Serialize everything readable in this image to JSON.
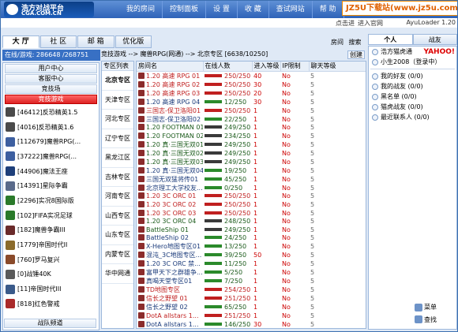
{
  "app": {
    "logo_line1": "浩方对战平台",
    "logo_line2": "CGA.COM.CN",
    "watermark": "JZ5U下载站(www.jz5u.com)"
  },
  "menu": [
    "我的房间",
    "控制面板",
    "设 置",
    "收 藏",
    "查试网站",
    "帮 助"
  ],
  "row2": {
    "link": "点击进",
    "link2": "进入官网",
    "user": "AyuLoader 1.20"
  },
  "tabs": [
    "大 厅",
    "社 区",
    "邮 箱",
    "优化版"
  ],
  "online_text": "在线/游戏: 286648 /268751",
  "categories": [
    {
      "label": "用户中心",
      "active": false
    },
    {
      "label": "客服中心",
      "active": false
    },
    {
      "label": "竞技场",
      "active": false
    },
    {
      "label": "竞技游戏",
      "active": true
    }
  ],
  "games": [
    {
      "label": "[46412]反恐精英1.5",
      "icon_color": "#4a4a4a"
    },
    {
      "label": "[4016]反恐精英1.6",
      "icon_color": "#4a4a4a"
    },
    {
      "label": "[112679]魔兽RPG(...",
      "icon_color": "#3d5fa0"
    },
    {
      "label": "[37222]魔兽RPG(...",
      "icon_color": "#3d5fa0"
    },
    {
      "label": "[44906]魔法王座",
      "icon_color": "#1e3f7a"
    },
    {
      "label": "[14391]星际争霸",
      "icon_color": "#5a6a8a"
    },
    {
      "label": "[2296]实况8国际版",
      "icon_color": "#2a7a2a"
    },
    {
      "label": "[102]FIFA实况足球",
      "icon_color": "#2a7a2a"
    },
    {
      "label": "[182]魔兽争霸III",
      "icon_color": "#6a2a2a"
    },
    {
      "label": "[1779]帝国时代II",
      "icon_color": "#8a6a2a"
    },
    {
      "label": "[760]罗马复兴",
      "icon_color": "#8a4a2a"
    },
    {
      "label": "[0]战锤40K",
      "icon_color": "#5a5a5a"
    },
    {
      "label": "[11]帝国时代III",
      "icon_color": "#3a5a8a"
    },
    {
      "label": "[818]红色警戒",
      "icon_color": "#aa2a2a"
    }
  ],
  "bottom_category": "战队频道",
  "breadcrumb": "竞技游戏 --> 魔兽RPG(网通) --> 北京专区 [6638/10250]",
  "breadcrumb_btn": "创建",
  "zones_header": "专区列表",
  "zones": [
    {
      "label": "北京专区",
      "active": true
    },
    {
      "label": "天津专区",
      "active": false
    },
    {
      "label": "河北专区",
      "active": false
    },
    {
      "label": "辽宁专区",
      "active": false
    },
    {
      "label": "黑龙江区",
      "active": false
    },
    {
      "label": "吉林专区",
      "active": false
    },
    {
      "label": "河南专区",
      "active": false
    },
    {
      "label": "山西专区",
      "active": false
    },
    {
      "label": "山东专区",
      "active": false
    },
    {
      "label": "内蒙专区",
      "active": false
    },
    {
      "label": "华中网通",
      "active": false
    }
  ],
  "table": {
    "headers": [
      "房间名",
      "在线人数",
      "进入等级",
      "IP限制",
      "聊天等级"
    ],
    "rows": [
      {
        "name": "1.20 高速 RPG 01",
        "online": "250/250",
        "level": "40",
        "ip": "No",
        "chat": "5"
      },
      {
        "name": "1.20 高速 RPG 02",
        "online": "250/250",
        "level": "30",
        "ip": "No",
        "chat": "5"
      },
      {
        "name": "1.20 高速 RPG 03",
        "online": "250/250",
        "level": "20",
        "ip": "No",
        "chat": "5"
      },
      {
        "name": "1.20 高速 RPG 04",
        "online": "12/250",
        "level": "30",
        "ip": "No",
        "chat": "5"
      },
      {
        "name": "三国志-保卫洛阳01",
        "online": "250/250",
        "level": "1",
        "ip": "No",
        "chat": "5"
      },
      {
        "name": "三国志-保卫洛阳02",
        "online": "22/250",
        "level": "1",
        "ip": "No",
        "chat": "5"
      },
      {
        "name": "1.20 FOOTMAN 01",
        "online": "249/250",
        "level": "1",
        "ip": "No",
        "chat": "5"
      },
      {
        "name": "1.20 FOOTMAN 02",
        "online": "234/250",
        "level": "1",
        "ip": "No",
        "chat": "5"
      },
      {
        "name": "1.20 真·三国无双01",
        "online": "249/250",
        "level": "1",
        "ip": "No",
        "chat": "5"
      },
      {
        "name": "1.20 真·三国无双02",
        "online": "249/250",
        "level": "1",
        "ip": "No",
        "chat": "5"
      },
      {
        "name": "1.20 真·三国无双03",
        "online": "249/250",
        "level": "1",
        "ip": "No",
        "chat": "5"
      },
      {
        "name": "1.20 真·三国无双04",
        "online": "19/250",
        "level": "1",
        "ip": "No",
        "chat": "5"
      },
      {
        "name": "三国无双猛将传01",
        "online": "45/250",
        "level": "1",
        "ip": "No",
        "chat": "5"
      },
      {
        "name": "北京理工大学校友...",
        "online": "0/250",
        "level": "1",
        "ip": "No",
        "chat": "5"
      },
      {
        "name": "1.20 3C ORC 01",
        "online": "250/250",
        "level": "1",
        "ip": "No",
        "chat": "5"
      },
      {
        "name": "1.20 3C ORC 02",
        "online": "250/250",
        "level": "1",
        "ip": "No",
        "chat": "5"
      },
      {
        "name": "1.20 3C ORC 03",
        "online": "250/250",
        "level": "1",
        "ip": "No",
        "chat": "5"
      },
      {
        "name": "1.20 3C ORC 04",
        "online": "248/250",
        "level": "1",
        "ip": "No",
        "chat": "5"
      },
      {
        "name": "BattleShip 01",
        "online": "249/250",
        "level": "1",
        "ip": "No",
        "chat": "5"
      },
      {
        "name": "BattleShip 02",
        "online": "24/250",
        "level": "1",
        "ip": "No",
        "chat": "5"
      },
      {
        "name": "X-Hero地图专区01",
        "online": "13/250",
        "level": "1",
        "ip": "No",
        "chat": "5"
      },
      {
        "name": "混沌_3C地图专区...",
        "online": "39/250",
        "level": "50",
        "ip": "No",
        "chat": "5"
      },
      {
        "name": "1.20 3C ORC 禁...",
        "online": "11/250",
        "level": "1",
        "ip": "No",
        "chat": "5"
      },
      {
        "name": "富甲天下之群雄争...",
        "online": "5/250",
        "level": "1",
        "ip": "No",
        "chat": "5"
      },
      {
        "name": "真喝天堂专区01",
        "online": "7/250",
        "level": "1",
        "ip": "No",
        "chat": "5"
      },
      {
        "name": "TD地图专区",
        "online": "254/250",
        "level": "1",
        "ip": "No",
        "chat": "5"
      },
      {
        "name": "信长之野望 01",
        "online": "251/250",
        "level": "1",
        "ip": "No",
        "chat": "5"
      },
      {
        "name": "信长之野望 02",
        "online": "65/250",
        "level": "1",
        "ip": "No",
        "chat": "5"
      },
      {
        "name": "DotA allstars 1...",
        "online": "251/250",
        "level": "1",
        "ip": "No",
        "chat": "5"
      },
      {
        "name": "DotA allstars 1...",
        "online": "146/250",
        "level": "30",
        "ip": "No",
        "chat": "5"
      }
    ]
  },
  "right": {
    "top_icons": [
      "房间",
      "搜索"
    ],
    "tabs": [
      "个人",
      "战友"
    ],
    "yahoo": "YAHOO!",
    "user1": "浩方猫虎通",
    "user2": "小生2008（登录中）",
    "groups": [
      "我的好友 (0/0)",
      "我的战友 (0/0)",
      "黑名单 (0/0)",
      "猫虎战友 (0/0)",
      "最近联系人 (0/0)"
    ],
    "buttons": [
      "菜单",
      "查找"
    ]
  },
  "colors": {
    "accent": "#2e63b8",
    "active_category": "#dd2222",
    "bar_full": "#c02020",
    "bar_ok": "#2b8a2b"
  }
}
